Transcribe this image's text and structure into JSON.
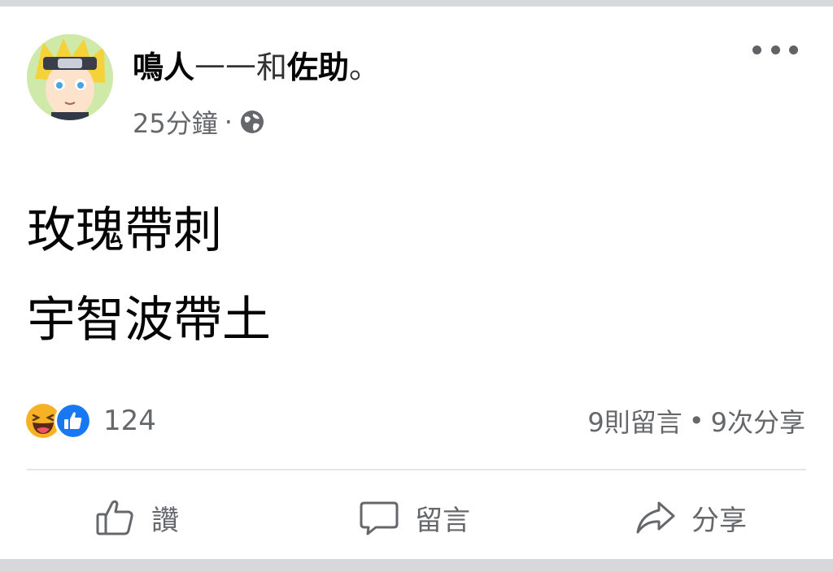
{
  "post": {
    "author": "鳴人",
    "dash": "——",
    "with_word": "和",
    "tagged": "佐助",
    "period": "。",
    "time": "25分鐘",
    "dot": "·",
    "privacy_icon": "globe-icon",
    "more_icon": "more-options-icon",
    "lines": [
      "玫瑰帶刺",
      "宇智波帶土"
    ]
  },
  "reactions": {
    "icons": [
      "haha-emoji-icon",
      "like-thumb-icon"
    ],
    "count": "124"
  },
  "stats": {
    "comments": "9則留言",
    "separator": "•",
    "shares": "9次分享"
  },
  "actions": {
    "like": "讚",
    "comment": "留言",
    "share": "分享"
  },
  "colors": {
    "like_blue": "#1877f2",
    "haha_yellow": "#f7b125",
    "secondary_text": "#65676b"
  }
}
